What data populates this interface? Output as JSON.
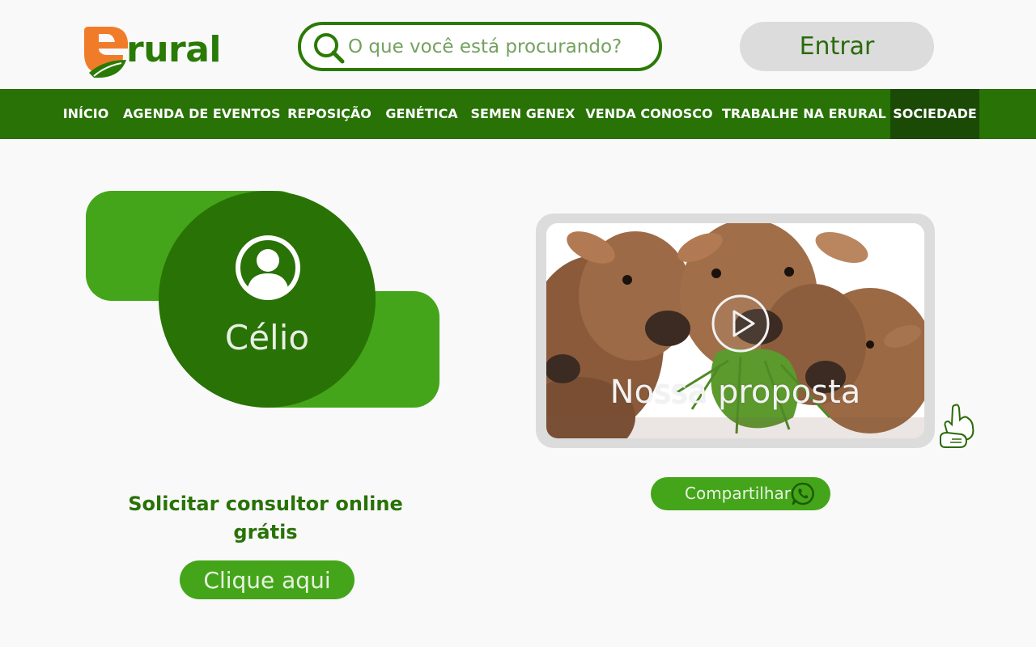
{
  "header": {
    "logo_text": "rural",
    "search_placeholder": "O que você está procurando?",
    "login_label": "Entrar"
  },
  "nav": {
    "items": [
      {
        "label": "INÍCIO"
      },
      {
        "label": "AGENDA DE EVENTOS"
      },
      {
        "label": "REPOSIÇÃO"
      },
      {
        "label": "GENÉTICA"
      },
      {
        "label": "SEMEN GENEX"
      },
      {
        "label": "VENDA CONOSCO"
      },
      {
        "label": "TRABALHE NA ERURAL"
      },
      {
        "label": "SOCIEDADE"
      }
    ],
    "active": "SOCIEDADE"
  },
  "consultant": {
    "name": "Célio",
    "cta_text": "Solicitar consultor online grátis",
    "cta_button": "Clique aqui"
  },
  "video": {
    "title": "Nossa proposta",
    "share_label": "Compartilhar"
  },
  "colors": {
    "brand_green": "#287206",
    "light_green": "#44a51a",
    "logo_orange": "#f07c2a",
    "active_nav": "#1b4a06"
  },
  "icons": {
    "search": "search-icon",
    "user": "user-circle-icon",
    "play": "play-icon",
    "share": "whatsapp-icon",
    "accessibility": "libras-hands-icon"
  }
}
